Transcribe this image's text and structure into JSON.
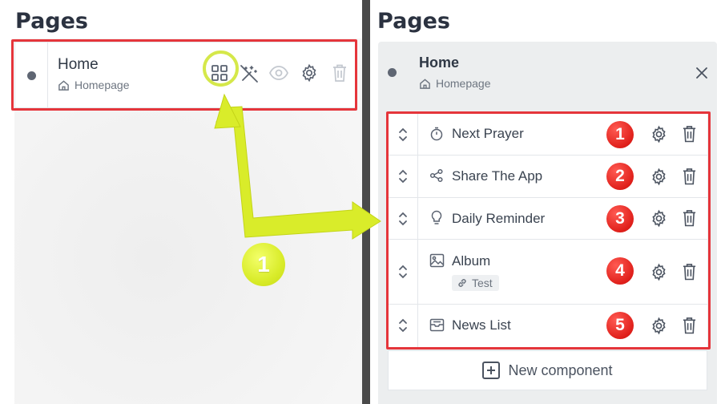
{
  "left_panel": {
    "title": "Pages",
    "page": {
      "name": "Home",
      "subtitle": "Homepage"
    },
    "actions": [
      "components-grid-icon",
      "no-magic-icon",
      "eye-icon",
      "gear-icon",
      "trash-icon"
    ]
  },
  "right_panel": {
    "title": "Pages",
    "page": {
      "name": "Home",
      "subtitle": "Homepage"
    },
    "components": [
      {
        "label": "Next Prayer",
        "icon": "timer-icon",
        "number": "1"
      },
      {
        "label": "Share The App",
        "icon": "share-icon",
        "number": "2"
      },
      {
        "label": "Daily Reminder",
        "icon": "lightbulb-icon",
        "number": "3"
      },
      {
        "label": "Album",
        "icon": "image-icon",
        "number": "4",
        "tag": "Test"
      },
      {
        "label": "News List",
        "icon": "inbox-icon",
        "number": "5"
      }
    ],
    "new_component_label": "New component"
  },
  "callout": {
    "number": "1"
  },
  "colors": {
    "highlight_red": "#e5353b",
    "callout_yellow": "#d9ec2a",
    "badge_red": "#e0201b"
  }
}
